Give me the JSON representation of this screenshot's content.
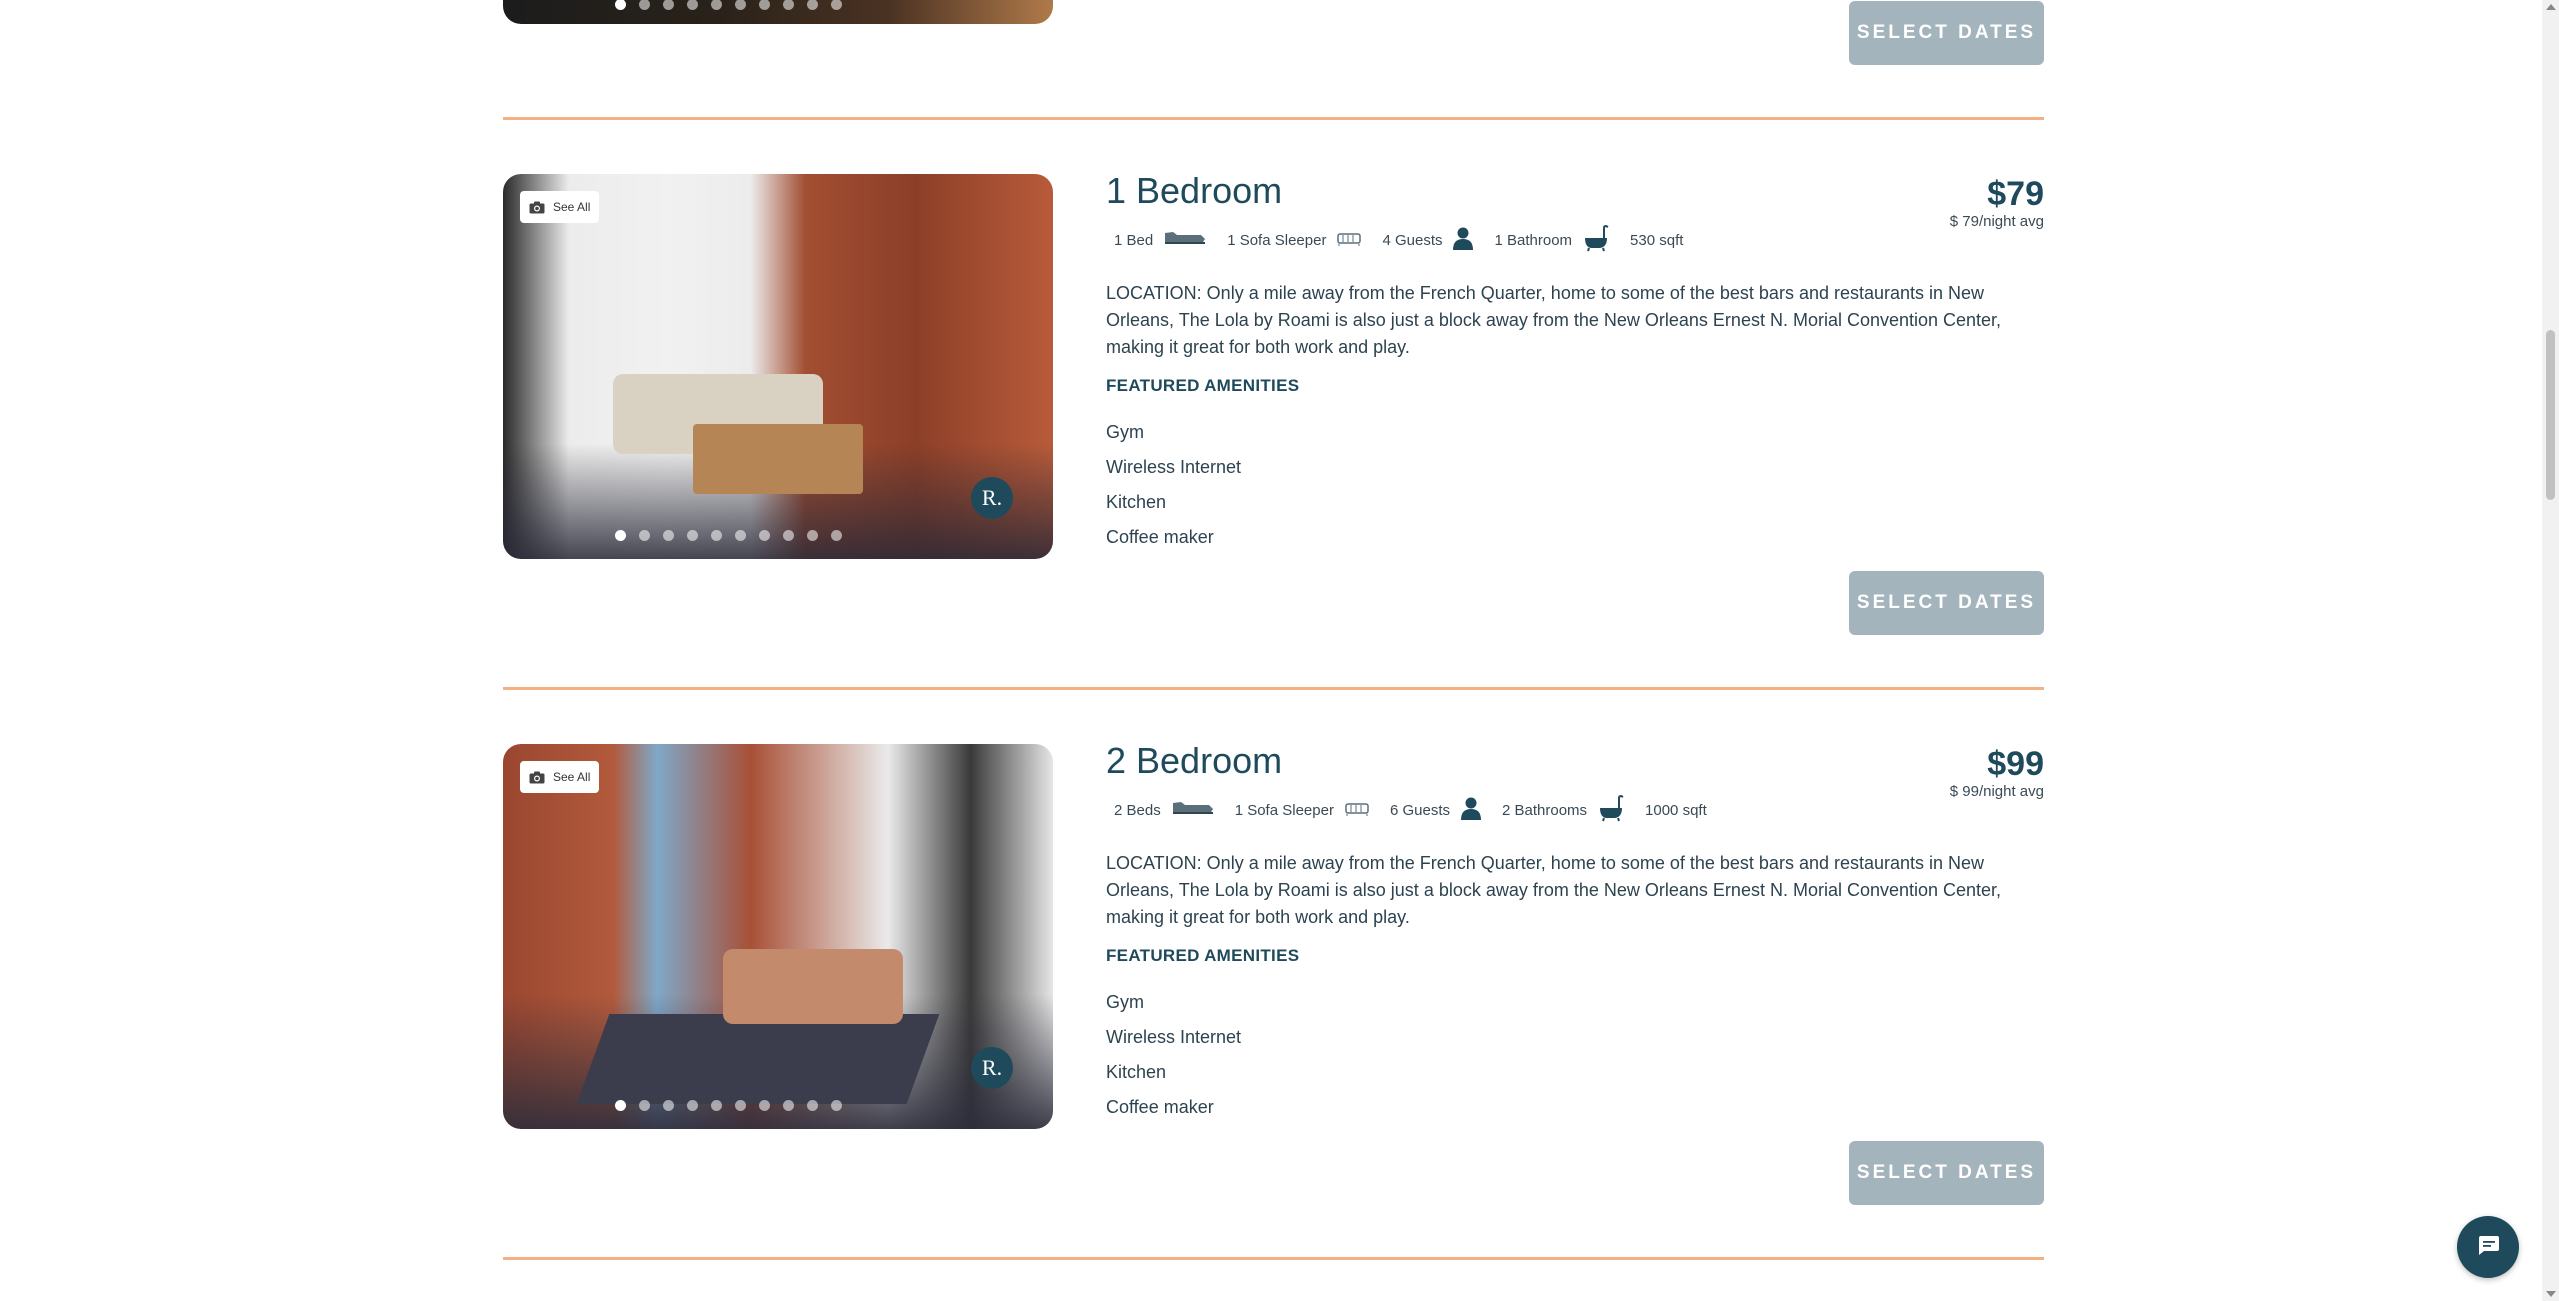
{
  "top_listing": {
    "select_label": "SELECT DATES",
    "photo_count": 10
  },
  "listings": [
    {
      "title": "1 Bedroom",
      "see_all": "See All",
      "beds": "1 Bed",
      "sleeper": "1 Sofa Sleeper",
      "guests": "4 Guests",
      "bathrooms": "1 Bathroom",
      "size": "530 sqft",
      "price": "$79",
      "price_note": "$ 79/night avg",
      "description": "LOCATION: Only a mile away from the French Quarter, home to some of the best bars and restaurants in New Orleans, The Lola by Roami is also just a block away from the New Orleans Ernest N. Morial Convention Center, making it great for both work and play.",
      "featured_title": "FEATURED AMENITIES",
      "amenities": [
        "Gym",
        "Wireless Internet",
        "Kitchen",
        "Coffee maker"
      ],
      "select_label": "SELECT DATES",
      "logo_letter": "R.",
      "photo_count": 10,
      "active_photo": 1
    },
    {
      "title": "2 Bedroom",
      "see_all": "See All",
      "beds": "2 Beds",
      "sleeper": "1 Sofa Sleeper",
      "guests": "6 Guests",
      "bathrooms": "2 Bathrooms",
      "size": "1000 sqft",
      "price": "$99",
      "price_note": "$ 99/night avg",
      "description": "LOCATION: Only a mile away from the French Quarter, home to some of the best bars and restaurants in New Orleans, The Lola by Roami is also just a block away from the New Orleans Ernest N. Morial Convention Center, making it great for both work and play.",
      "featured_title": "FEATURED AMENITIES",
      "amenities": [
        "Gym",
        "Wireless Internet",
        "Kitchen",
        "Coffee maker"
      ],
      "select_label": "SELECT DATES",
      "logo_letter": "R.",
      "photo_count": 10,
      "active_photo": 1
    }
  ],
  "icons": {
    "bed": "bed-icon",
    "sofa": "sofa-icon",
    "guest": "person-icon",
    "bath": "bathtub-icon",
    "camera": "camera-icon",
    "chat": "chat-icon"
  },
  "colors": {
    "primary": "#1f4a5c",
    "button_disabled": "#a3b4bc",
    "divider": "#f4b184"
  }
}
